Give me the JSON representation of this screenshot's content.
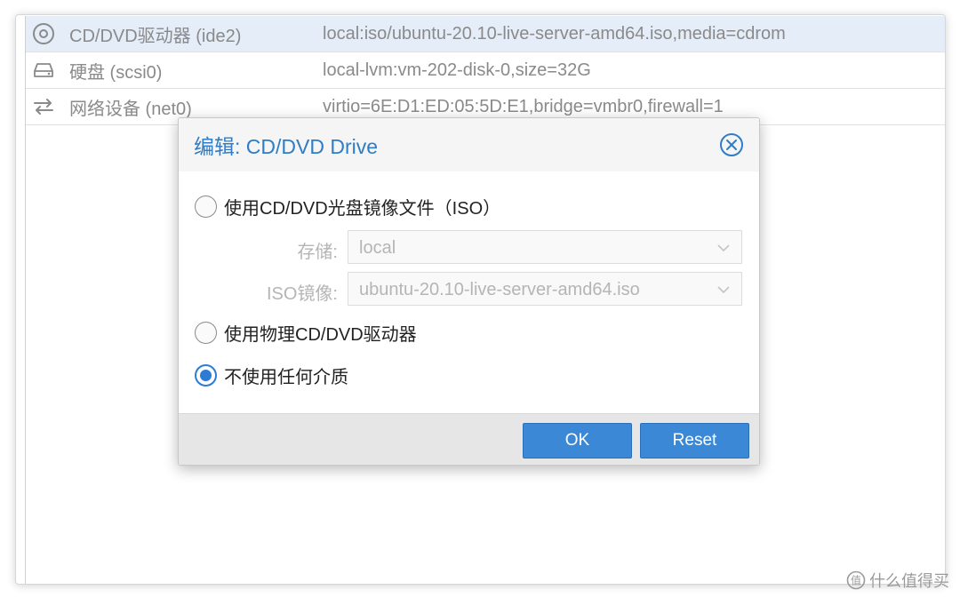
{
  "hardware": {
    "rows": [
      {
        "name": "CD/DVD驱动器 (ide2)",
        "value": "local:iso/ubuntu-20.10-live-server-amd64.iso,media=cdrom",
        "icon": "cdrom-icon"
      },
      {
        "name": "硬盘 (scsi0)",
        "value": "local-lvm:vm-202-disk-0,size=32G",
        "icon": "hard-disk-icon"
      },
      {
        "name": "网络设备 (net0)",
        "value": "virtio=6E:D1:ED:05:5D:E1,bridge=vmbr0,firewall=1",
        "icon": "network-arrows-icon"
      }
    ]
  },
  "dialog": {
    "title": "编辑: CD/DVD Drive",
    "options": {
      "iso": "使用CD/DVD光盘镜像文件（ISO）",
      "physical": "使用物理CD/DVD驱动器",
      "none": "不使用任何介质"
    },
    "selected_option": "none",
    "storage": {
      "label": "存储:",
      "value": "local"
    },
    "iso_image": {
      "label": "ISO镜像:",
      "value": "ubuntu-20.10-live-server-amd64.iso"
    },
    "ok_label": "OK",
    "reset_label": "Reset"
  },
  "watermark": {
    "text": "什么值得买"
  },
  "colors": {
    "accent": "#2d7bd4",
    "title": "#2e7dc6",
    "button": "#3b88d6",
    "selected_row": "#e4edf8"
  }
}
